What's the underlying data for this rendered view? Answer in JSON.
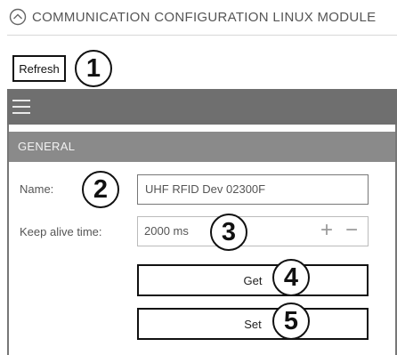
{
  "window": {
    "title": "COMMUNICATION CONFIGURATION LINUX MODULE"
  },
  "toolbar": {
    "refresh_label": "Refresh"
  },
  "callouts": [
    "1",
    "2",
    "3",
    "4",
    "5"
  ],
  "section": {
    "title": "GENERAL",
    "name_label": "Name:",
    "name_value": "UHF RFID Dev 02300F",
    "keepalive_label": "Keep alive time:",
    "keepalive_value": "2000 ms",
    "plus_label": "+",
    "minus_label": "−",
    "get_label": "Get",
    "set_label": "Set"
  },
  "colors": {
    "menubar": "#6f6f6f",
    "section_header": "#8a8a8a"
  },
  "icons": {
    "title": "chevron-up-circle-icon",
    "menu": "hamburger-menu-icon"
  }
}
